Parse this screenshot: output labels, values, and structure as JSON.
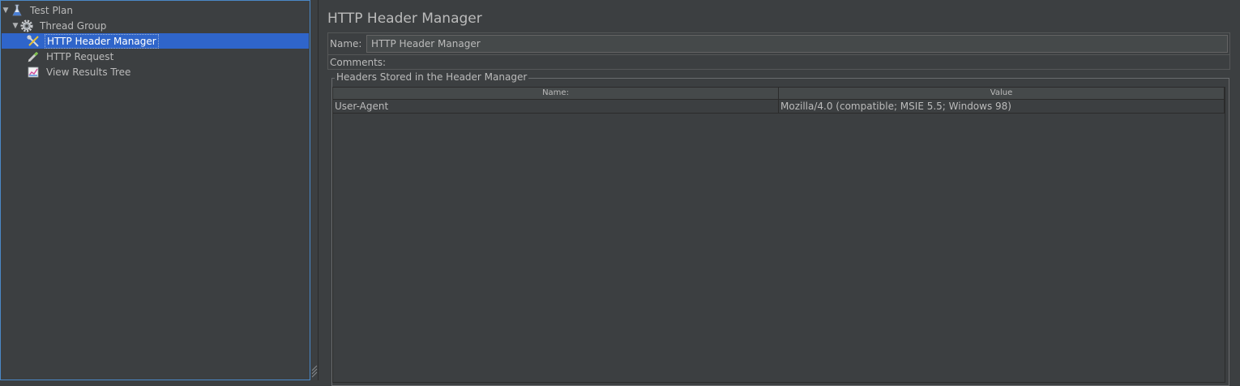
{
  "tree": {
    "items": [
      {
        "label": "Test Plan",
        "icon": "flask-icon",
        "expanded": true
      },
      {
        "label": "Thread Group",
        "icon": "gear-icon",
        "expanded": true
      },
      {
        "label": "HTTP Header Manager",
        "icon": "wrench-screwdriver-icon",
        "selected": true
      },
      {
        "label": "HTTP Request",
        "icon": "pencil-icon"
      },
      {
        "label": "View Results Tree",
        "icon": "chart-icon"
      }
    ]
  },
  "editor": {
    "title": "HTTP Header Manager",
    "name_label": "Name:",
    "name_value": "HTTP Header Manager",
    "comments_label": "Comments:",
    "headers_group_title": "Headers Stored in the Header Manager",
    "table": {
      "columns": [
        "Name:",
        "Value"
      ],
      "rows": [
        {
          "name": "User-Agent",
          "value": "Mozilla/4.0 (compatible; MSIE 5.5; Windows 98)"
        }
      ]
    }
  },
  "colors": {
    "background": "#3c3f41",
    "selection": "#2f65ca",
    "text": "#bbbbbb",
    "tree_border": "#4a88c7"
  }
}
